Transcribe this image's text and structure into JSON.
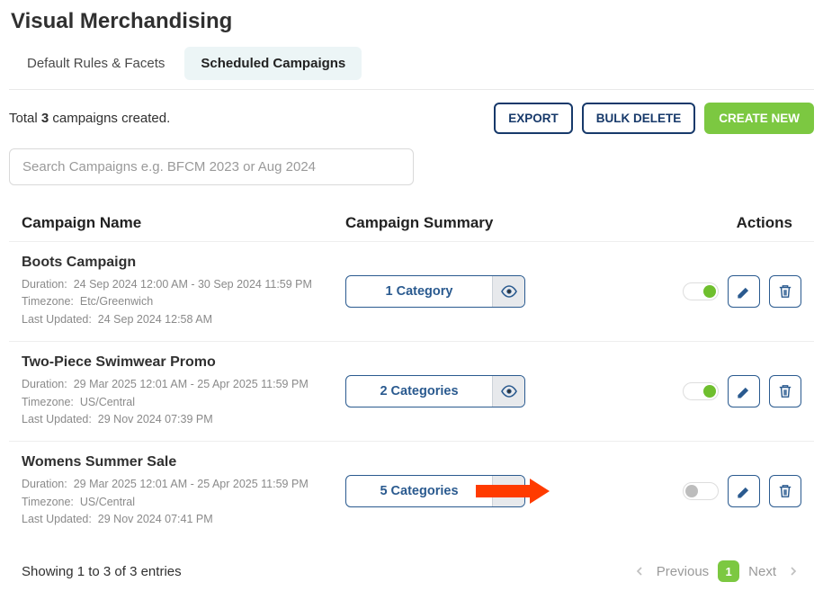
{
  "page_title": "Visual Merchandising",
  "tabs": {
    "default": "Default Rules & Facets",
    "scheduled": "Scheduled Campaigns"
  },
  "count": {
    "prefix": "Total ",
    "value": "3",
    "suffix": " campaigns created."
  },
  "buttons": {
    "export": "EXPORT",
    "bulk_delete": "BULK DELETE",
    "create_new": "CREATE NEW"
  },
  "search": {
    "placeholder": "Search Campaigns e.g. BFCM 2023 or Aug 2024",
    "value": ""
  },
  "columns": {
    "name": "Campaign Name",
    "summary": "Campaign Summary",
    "actions": "Actions"
  },
  "meta_labels": {
    "duration": "Duration:",
    "timezone": "Timezone:",
    "last_updated": "Last Updated:"
  },
  "rows": [
    {
      "name": "Boots Campaign",
      "duration": "24 Sep 2024 12:00 AM - 30 Sep 2024 11:59 PM",
      "timezone": "Etc/Greenwich",
      "last_updated": "24 Sep 2024 12:58 AM",
      "summary": "1 Category",
      "enabled": true,
      "annotate": false
    },
    {
      "name": "Two-Piece Swimwear Promo",
      "duration": "29 Mar 2025 12:01 AM - 25 Apr 2025 11:59 PM",
      "timezone": "US/Central",
      "last_updated": "29 Nov 2024 07:39 PM",
      "summary": "2 Categories",
      "enabled": true,
      "annotate": false
    },
    {
      "name": "Womens Summer Sale",
      "duration": "29 Mar 2025 12:01 AM - 25 Apr 2025 11:59 PM",
      "timezone": "US/Central",
      "last_updated": "29 Nov 2024 07:41 PM",
      "summary": "5 Categories",
      "enabled": false,
      "annotate": true
    }
  ],
  "footer": {
    "showing": "Showing 1 to 3 of 3 entries",
    "previous": "Previous",
    "next": "Next",
    "page": "1"
  }
}
